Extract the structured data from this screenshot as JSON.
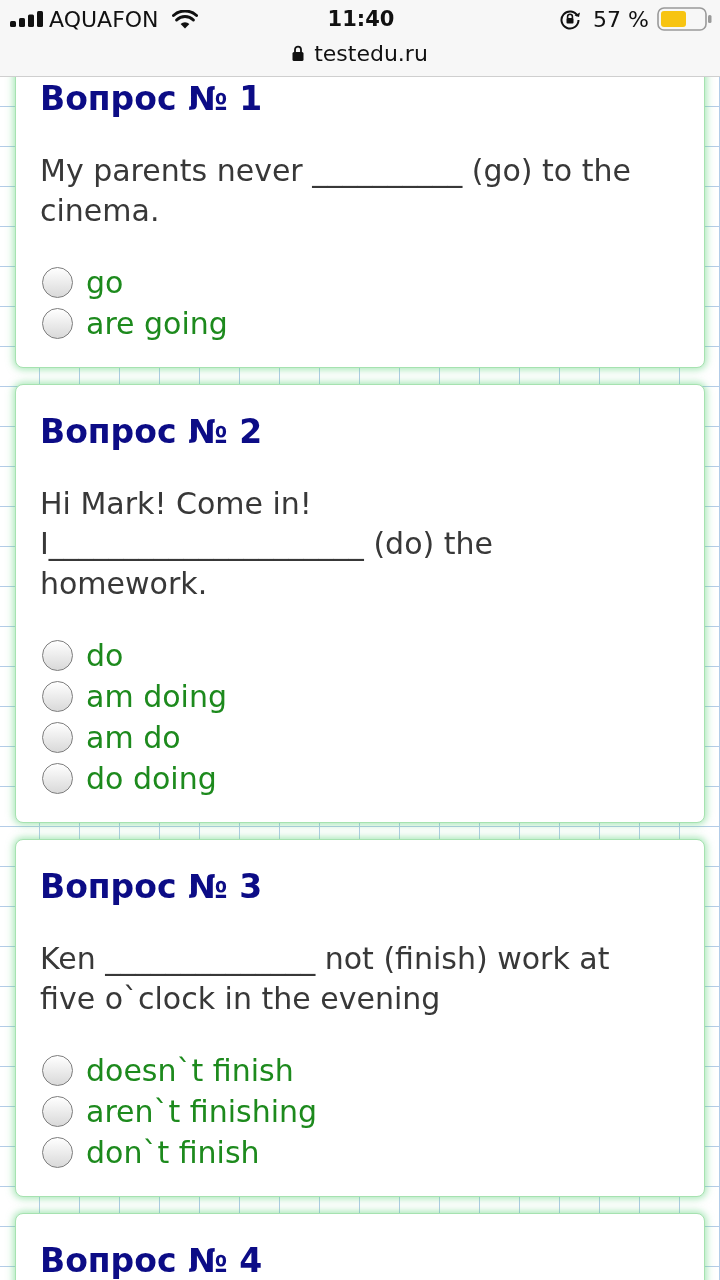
{
  "status_bar": {
    "carrier": "AQUAFON",
    "time": "11:40",
    "battery": "57 %",
    "url": "testedu.ru"
  },
  "questions": [
    {
      "title": "Вопрос № 1",
      "text": [
        "My parents never __________ (go) to the",
        "cinema."
      ],
      "options": [
        {
          "label": "go",
          "selected": false
        },
        {
          "label": "are going",
          "selected": false
        }
      ]
    },
    {
      "title": "Вопрос № 2",
      "text": [
        "Hi Mark! Come in!",
        "I_____________________ (do) the",
        "homework."
      ],
      "options": [
        {
          "label": "do",
          "selected": false
        },
        {
          "label": "am doing",
          "selected": false
        },
        {
          "label": "am do",
          "selected": false
        },
        {
          "label": "do doing",
          "selected": false
        }
      ]
    },
    {
      "title": "Вопрос № 3",
      "text": [
        "Ken ______________ not (finish) work at",
        "five o`clock in the evening"
      ],
      "options": [
        {
          "label": "doesn`t finish",
          "selected": false
        },
        {
          "label": "aren`t finishing",
          "selected": false
        },
        {
          "label": "don`t finish",
          "selected": false
        }
      ]
    },
    {
      "title": "Вопрос № 4"
    }
  ]
}
